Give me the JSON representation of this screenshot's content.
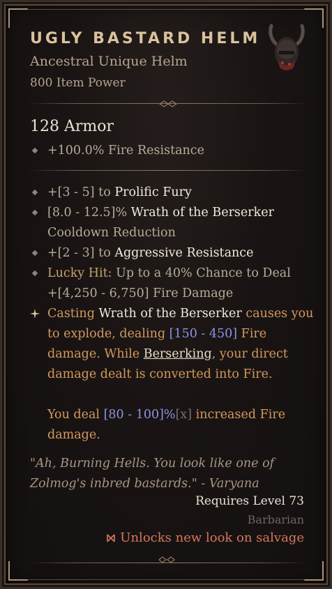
{
  "item": {
    "name": "UGLY BASTARD HELM",
    "type_line": "Ancestral Unique Helm",
    "item_power": "800 Item Power",
    "armor": "128 Armor",
    "implicit": "+100.0% Fire Resistance",
    "icon": "helm-icon"
  },
  "affixes": [
    {
      "prefix": "+[3 - 5] to ",
      "name": "Prolific Fury"
    },
    {
      "prefix": "[8.0 - 12.5]% ",
      "name": "Wrath of the Berserker",
      "line2": "Cooldown Reduction"
    },
    {
      "prefix": "+[2 - 3] to ",
      "name": "Aggressive Resistance"
    },
    {
      "label": "Lucky Hit",
      "text": ": Up to a 40% Chance to Deal",
      "line2": "+[4,250 - 6,750] Fire Damage"
    }
  ],
  "unique_power": {
    "l1_a": "Casting ",
    "l1_b": "Wrath of the Berserker",
    "l1_c": " causes you",
    "l2_a": "to explode, dealing ",
    "l2_b": "[150 - 450]",
    "l2_c": " Fire",
    "l3_a": "damage. While ",
    "l3_b": "Berserking",
    "l3_c": ", your direct",
    "l4": "damage dealt is converted into Fire.",
    "l5_a": "You deal ",
    "l5_b": "[80 - 100]%",
    "l5_c": "[x]",
    "l5_d": " increased Fire",
    "l6": "damage."
  },
  "flavor": {
    "line1": "\"Ah, Burning Hells. You look like one of",
    "line2": "Zolmog's inbred bastards.\" - Varyana"
  },
  "requirements": {
    "level": "Requires Level 73",
    "class": "Barbarian",
    "unlock": "Unlocks new look on salvage"
  },
  "colors": {
    "title": "#d9c29d",
    "affix_highlight": "#f2eadd",
    "unique_power": "#d4995d",
    "value_range": "#8b94e6",
    "unlock": "#d4785a"
  }
}
